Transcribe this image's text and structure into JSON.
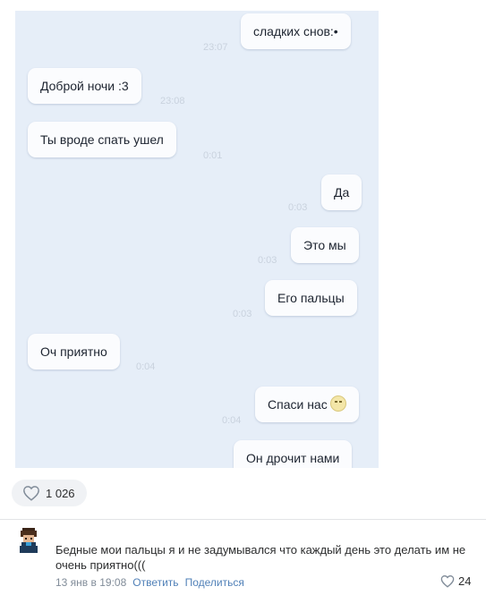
{
  "chat": {
    "messages": [
      {
        "text": "сладких снов:•",
        "time": "23:07"
      },
      {
        "text": "Доброй ночи :3",
        "time": "23:08"
      },
      {
        "text": "Ты вроде спать ушел",
        "time": "0:01"
      },
      {
        "text": "Да",
        "time": "0:03"
      },
      {
        "text": "Это мы",
        "time": "0:03"
      },
      {
        "text": "Его пальцы",
        "time": "0:03"
      },
      {
        "text": "Оч приятно",
        "time": "0:04"
      },
      {
        "text": "Спаси нас",
        "time": "0:04"
      },
      {
        "text": "Он дрочит нами",
        "time": ""
      }
    ]
  },
  "post": {
    "likes": "1 026"
  },
  "comment": {
    "text": "Бедные мои пальцы я и не задумывался что каждый день это делать им не очень приятно(((",
    "date": "13 янв в 19:08",
    "reply_label": "Ответить",
    "share_label": "Поделиться",
    "likes": "24"
  },
  "icons": {
    "like": "heart-outline-icon",
    "emoji": "confused-face-emoji-icon"
  },
  "colors": {
    "link": "#5181b8",
    "meta": "#818c99",
    "chat_bg": "#e6eef8"
  }
}
